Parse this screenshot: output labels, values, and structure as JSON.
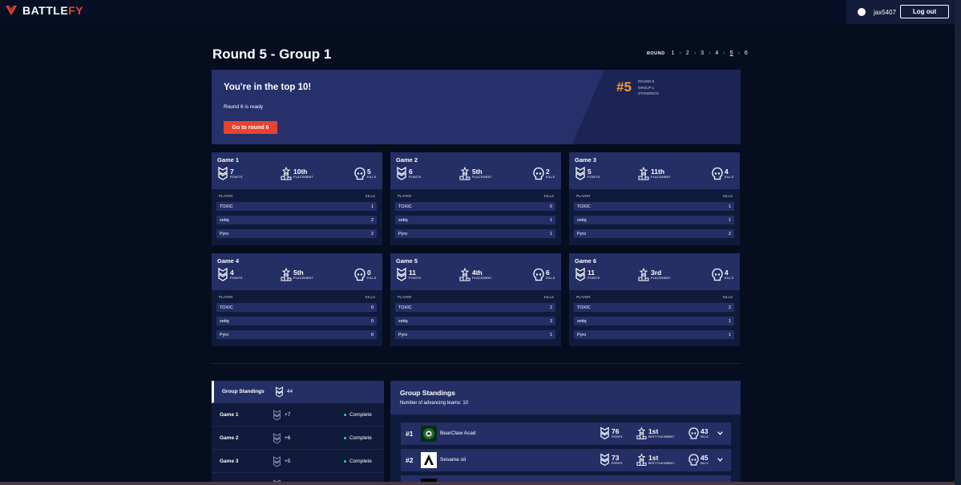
{
  "brand": {
    "name_a": "BATTLE",
    "name_b": "FY",
    "accent": "#e8432e"
  },
  "user": {
    "username": "jax5407",
    "logout_label": "Log out"
  },
  "page": {
    "title": "Round 5 - Group 1"
  },
  "round_nav": {
    "label": "ROUND",
    "rounds": [
      "1",
      "2",
      "3",
      "4",
      "5",
      "6"
    ],
    "current": "5"
  },
  "banner": {
    "headline": "You're in the top 10!",
    "status": "Round 6 is ready",
    "button_label": "Go to round 6",
    "rank": "#5",
    "rank_lines": [
      "ROUND 5",
      "GROUP 1",
      "STANDINGS"
    ],
    "rank_color": "#f59b36"
  },
  "labels": {
    "points": "POINTS",
    "placement": "PLACEMENT",
    "kills": "KILLS",
    "player": "PLAYER",
    "best_placement": "BEST PLACEMENT"
  },
  "games": [
    {
      "title": "Game 1",
      "points": "7",
      "placement": "10th",
      "kills": "5",
      "players": [
        {
          "name": "TOXIC",
          "kills": "1"
        },
        {
          "name": "xetiq",
          "kills": "2"
        },
        {
          "name": "Pyro",
          "kills": "2"
        }
      ]
    },
    {
      "title": "Game 2",
      "points": "6",
      "placement": "5th",
      "kills": "2",
      "players": [
        {
          "name": "TOXIC",
          "kills": "0"
        },
        {
          "name": "xetiq",
          "kills": "1"
        },
        {
          "name": "Pyro",
          "kills": "1"
        }
      ]
    },
    {
      "title": "Game 3",
      "points": "5",
      "placement": "11th",
      "kills": "4",
      "players": [
        {
          "name": "TOXIC",
          "kills": "1"
        },
        {
          "name": "xetiq",
          "kills": "1"
        },
        {
          "name": "Pyro",
          "kills": "2"
        }
      ]
    },
    {
      "title": "Game 4",
      "points": "4",
      "placement": "5th",
      "kills": "0",
      "players": [
        {
          "name": "TOXIC",
          "kills": "0"
        },
        {
          "name": "xetiq",
          "kills": "0"
        },
        {
          "name": "Pyro",
          "kills": "0"
        }
      ]
    },
    {
      "title": "Game 5",
      "points": "11",
      "placement": "4th",
      "kills": "6",
      "players": [
        {
          "name": "TOXIC",
          "kills": "2"
        },
        {
          "name": "xetiq",
          "kills": "3"
        },
        {
          "name": "Pyro",
          "kills": "1"
        }
      ]
    },
    {
      "title": "Game 6",
      "points": "11",
      "placement": "3rd",
      "kills": "4",
      "players": [
        {
          "name": "TOXIC",
          "kills": "2"
        },
        {
          "name": "xetiq",
          "kills": "1"
        },
        {
          "name": "Pyro",
          "kills": "1"
        }
      ]
    }
  ],
  "sidebar": [
    {
      "name": "Group Standings",
      "points": "44",
      "status": ""
    },
    {
      "name": "Game 1",
      "points": "+7",
      "status": "Complete"
    },
    {
      "name": "Game 2",
      "points": "+6",
      "status": "Complete"
    },
    {
      "name": "Game 3",
      "points": "+5",
      "status": "Complete"
    }
  ],
  "group_standings": {
    "title": "Group Standings",
    "subtitle": "Number of advancing teams: 10",
    "teams": [
      {
        "rank": "#1",
        "name": "BearClaw Acad",
        "points": "76",
        "best": "1st",
        "kills": "43"
      },
      {
        "rank": "#2",
        "name": "Sesame oil",
        "points": "73",
        "best": "1st",
        "kills": "45"
      }
    ]
  }
}
